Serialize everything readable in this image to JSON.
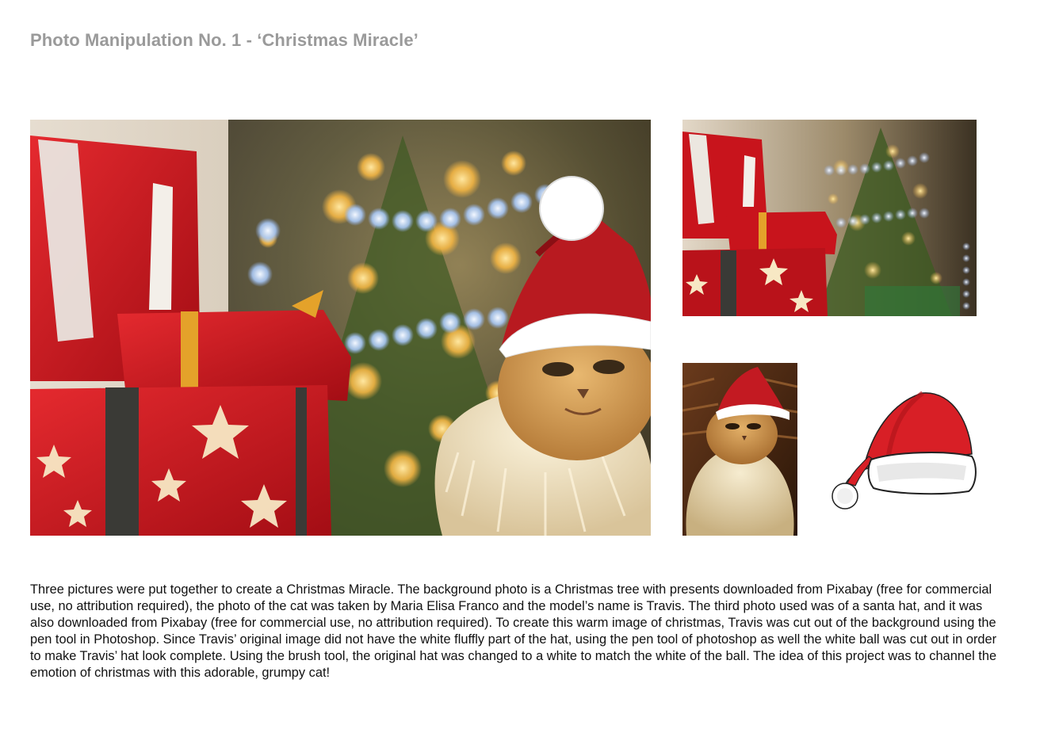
{
  "page": {
    "title": "Photo Manipulation No. 1 - ‘Christmas Miracle’",
    "description": "Three pictures were put together to create a Christmas Miracle. The background photo is a Christmas tree with presents downloaded from Pixabay (free for commercial use, no attribution required), the photo of the cat was taken by Maria Elisa Franco and the model’s name is Travis. The third photo used was of a santa hat, and it was also downloaded from Pixabay (free for commercial use, no attribution required). To create this warm image of christmas, Travis was cut out of the background using the pen tool in Photoshop. Since Travis’ original image did not have the white fluffly part of the hat, using the pen tool of photoshop as well the white ball was cut out in order to make Travis’ hat look complete. Using the brush tool, the original hat was changed to a white to match the white of the ball. The idea of this project was to channel the emotion of christmas with this adorable, grumpy cat!"
  },
  "colors": {
    "title_gray": "#9a9a9a",
    "present_red": "#c8141c",
    "hat_red": "#d81f26",
    "bokeh_gold": "#f2b544",
    "bokeh_blue": "#a9c8f5",
    "tree_green": "#3d5a22",
    "cat_fur": "#d7a35a"
  },
  "images": [
    {
      "name": "composite-christmas-miracle"
    },
    {
      "name": "background-tree-presents"
    },
    {
      "name": "travis-cat-original"
    },
    {
      "name": "santa-hat-clipart"
    }
  ]
}
